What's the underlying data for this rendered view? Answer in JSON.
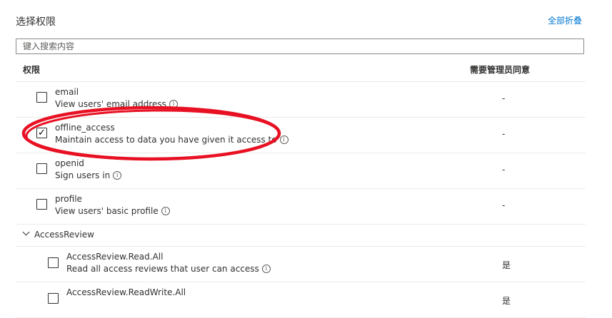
{
  "section": {
    "title": "选择权限",
    "collapse_all": "全部折叠"
  },
  "search": {
    "placeholder": "键入搜索内容"
  },
  "table": {
    "col_permission": "权限",
    "col_admin_consent": "需要管理员同意"
  },
  "permissions": [
    {
      "name": "email",
      "description": "View users' email address",
      "checked": false,
      "consent": "-"
    },
    {
      "name": "offline_access",
      "description": "Maintain access to data you have given it access to",
      "checked": true,
      "consent": "-"
    },
    {
      "name": "openid",
      "description": "Sign users in",
      "checked": false,
      "consent": "-"
    },
    {
      "name": "profile",
      "description": "View users' basic profile",
      "checked": false,
      "consent": "-"
    }
  ],
  "group": {
    "label": "AccessReview",
    "items": [
      {
        "name": "AccessReview.Read.All",
        "description": "Read all access reviews that user can access",
        "checked": false,
        "consent": "是"
      },
      {
        "name": "AccessReview.ReadWrite.All",
        "description": "",
        "checked": false,
        "consent": "是"
      }
    ]
  },
  "annotation": {
    "color": "#e81123"
  }
}
